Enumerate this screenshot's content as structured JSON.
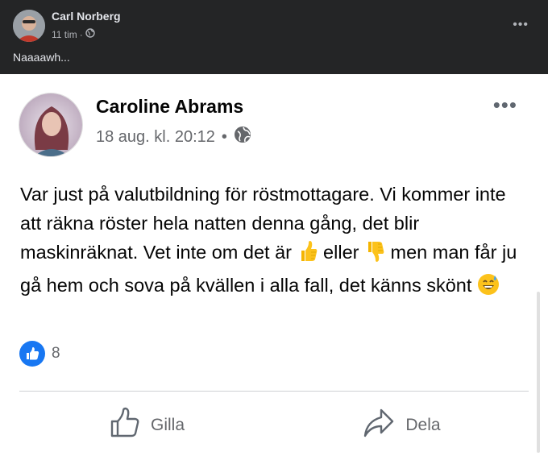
{
  "outer_post": {
    "author": "Carl Norberg",
    "time": "11 tim",
    "separator": "·",
    "text": "Naaaawh..."
  },
  "shared_post": {
    "author": "Caroline Abrams",
    "date": "18 aug. kl. 20:12",
    "separator": "•",
    "text_parts": {
      "p1": "Var just på valutbildning för röstmottagare. Vi kommer inte att räkna röster hela natten denna gång, det blir maskinräknat. Vet inte om det är ",
      "p2": " eller ",
      "p3": " men man får ju gå hem och sova på kvällen i alla fall, det känns skönt "
    },
    "emoji": {
      "e1": "thumbs-up-icon",
      "e2": "thumbs-down-icon",
      "e3": "grinning-sweat-icon"
    },
    "reaction_count": "8"
  },
  "actions": {
    "like_label": "Gilla",
    "share_label": "Dela"
  },
  "colors": {
    "outer_bg": "#242526",
    "like_blue": "#1877f2",
    "meta_gray": "#65676b"
  }
}
